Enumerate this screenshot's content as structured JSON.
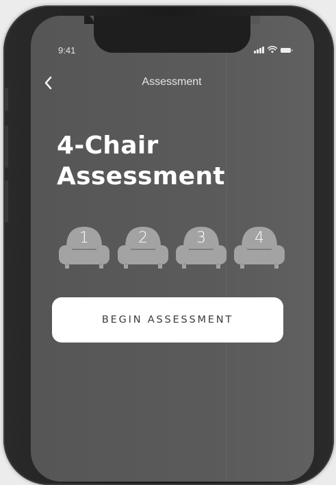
{
  "status_bar": {
    "time": "9:41"
  },
  "nav": {
    "title": "Assessment",
    "back_icon": "chevron-left-icon"
  },
  "heading": {
    "line1": "4-Chair",
    "line2": "Assessment"
  },
  "chairs": [
    {
      "number": "1",
      "icon": "armchair-icon"
    },
    {
      "number": "2",
      "icon": "armchair-icon"
    },
    {
      "number": "3",
      "icon": "armchair-icon"
    },
    {
      "number": "4",
      "icon": "armchair-icon"
    }
  ],
  "begin_button": {
    "label": "BEGIN ASSESSMENT"
  },
  "colors": {
    "screen_bg": "#5b5b5b",
    "chair": "#a3a3a3",
    "button_bg": "#ffffff",
    "button_text": "#3a3a3a"
  }
}
